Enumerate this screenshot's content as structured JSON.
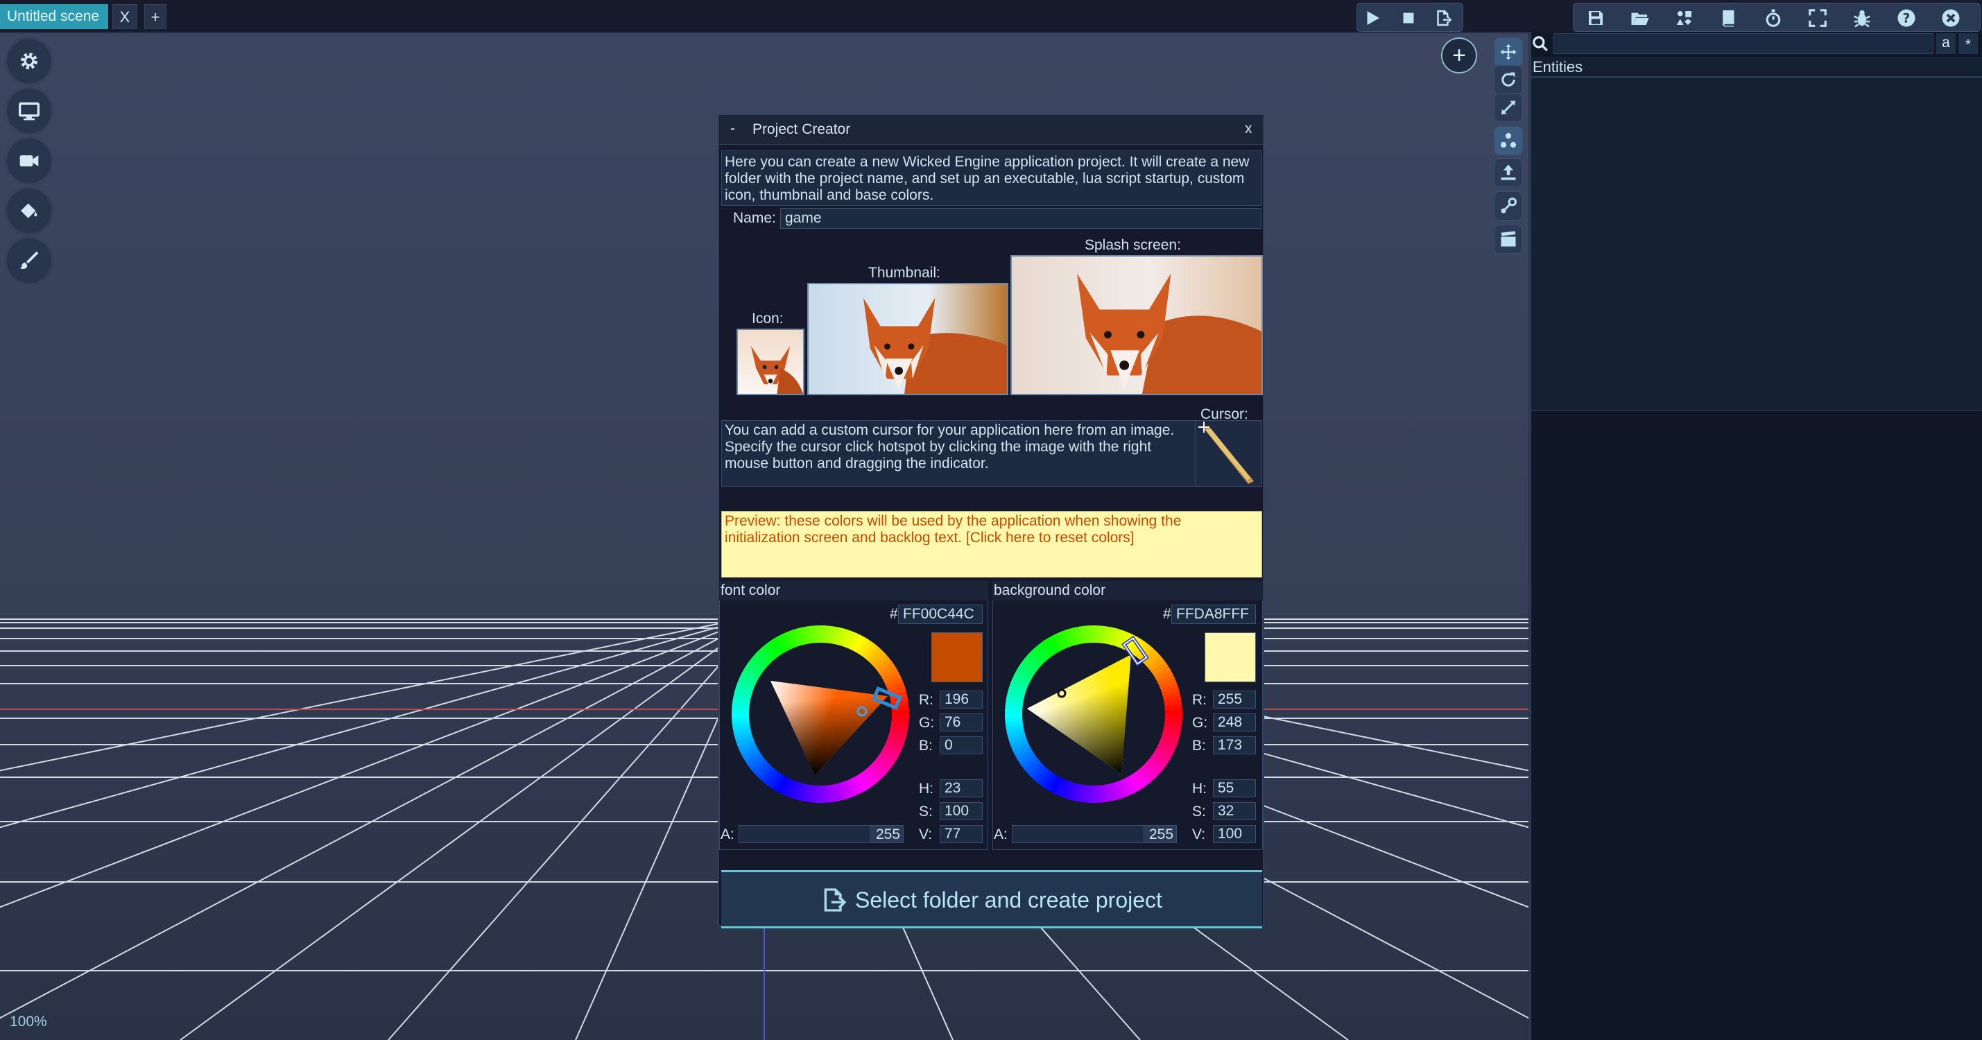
{
  "top_bar": {
    "scene_tab": "Untitled scene",
    "close_tab": "X",
    "new_tab": "+"
  },
  "toolbar_left_icons": [
    "gear-icon",
    "monitor-icon",
    "camera-icon",
    "paint-bucket-icon",
    "brush-icon"
  ],
  "toolbar_play_icons": [
    "play-icon",
    "stop-icon",
    "export-icon"
  ],
  "toolbar_right_icons": [
    "save-icon",
    "folder-open-icon",
    "component-icon",
    "book-icon",
    "stopwatch-icon",
    "fullscreen-icon",
    "bug-icon",
    "help-icon",
    "close-icon"
  ],
  "gizmo_icons": [
    "move-icon",
    "rotate-icon",
    "scale-icon",
    "cluster-icon",
    "up-arrow-icon",
    "physics-icon",
    "clapperboard-icon"
  ],
  "add_button": "+",
  "zoom_label": "100%",
  "entities": {
    "title": "Entities",
    "search_value": "",
    "filter_a": "a",
    "filter_star": "*"
  },
  "dialog": {
    "collapse": "-",
    "title": "Project Creator",
    "close": "x",
    "intro": "Here you can create a new Wicked Engine application project. It will create a new folder with the project name, and set up an executable, lua script startup, custom icon, thumbnail and base colors.",
    "name_label": "Name:",
    "name_value": "game",
    "icon_label": "Icon:",
    "thumbnail_label": "Thumbnail:",
    "splash_label": "Splash screen:",
    "cursor_label": "Cursor:",
    "cursor_text": "You can add a custom cursor for your application here from an image. Specify the cursor click hotspot by clicking the image with the right mouse button and dragging the indicator.",
    "preview_text": "Preview: these colors will be used by the application when showing the initialization screen and backlog text. [Click here to reset colors]",
    "font_color": {
      "label": "font color",
      "hash": "#",
      "hex": "FF00C44C",
      "swatch": "#c44c00",
      "hue_deg": 23,
      "sat_pct": 100,
      "val_pct": 77,
      "r_label": "R:",
      "r": "196",
      "g_label": "G:",
      "g": "76",
      "b_label": "B:",
      "b": "0",
      "h_label": "H:",
      "h": "23",
      "s_label": "S:",
      "s": "100",
      "v_label": "V:",
      "v": "77",
      "a_label": "A:",
      "a": "255"
    },
    "background_color": {
      "label": "background color",
      "hash": "#",
      "hex": "FFDA8FFF",
      "swatch": "#fff8ad",
      "hue_deg": 55,
      "sat_pct": 32,
      "val_pct": 100,
      "r_label": "R:",
      "r": "255",
      "g_label": "G:",
      "g": "248",
      "b_label": "B:",
      "b": "173",
      "h_label": "H:",
      "h": "55",
      "s_label": "S:",
      "s": "32",
      "v_label": "V:",
      "v": "100",
      "a_label": "A:",
      "a": "255"
    },
    "create_button": "Select folder and create project"
  }
}
